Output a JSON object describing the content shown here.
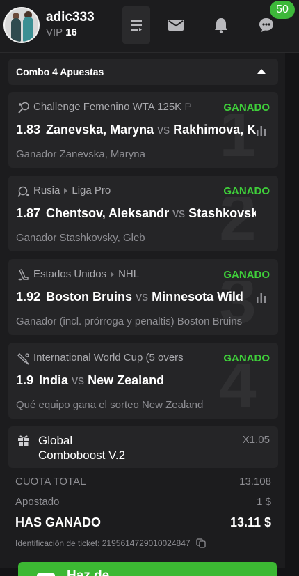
{
  "header": {
    "username": "adic333",
    "vip_label": "VIP",
    "vip_level": "16",
    "chat_badge_count": "50"
  },
  "combo": {
    "title": "Combo 4 Apuestas"
  },
  "legs": [
    {
      "number": "1",
      "sport_icon": "tennis-icon",
      "league_parts": [
        "Challenge Femenino WTA 125K "
      ],
      "league_fade": "P",
      "status": "GANADO",
      "odds": "1.83",
      "home": "Zanevska, Maryna",
      "vs": "vs",
      "away": "Rakhimova, K",
      "selection": "Ganador Zanevska, Maryna",
      "has_stats": true
    },
    {
      "number": "2",
      "sport_icon": "table-tennis-icon",
      "league_parts": [
        "Rusia",
        "Liga Pro"
      ],
      "league_fade": "",
      "status": "GANADO",
      "odds": "1.87",
      "home": "Chentsov, Aleksandr",
      "vs": "vs",
      "away": "Stashkovsk",
      "selection": "Ganador Stashkovsky, Gleb",
      "has_stats": false
    },
    {
      "number": "3",
      "sport_icon": "hockey-icon",
      "league_parts": [
        "Estados Unidos",
        "NHL"
      ],
      "league_fade": "",
      "status": "GANADO",
      "odds": "1.92",
      "home": "Boston Bruins",
      "vs": "vs",
      "away": "Minnesota Wild",
      "selection": "Ganador (incl. prórroga y penaltis) Boston Bruins",
      "has_stats": true
    },
    {
      "number": "4",
      "sport_icon": "cricket-icon",
      "league_parts": [
        "International World Cup (5 overs"
      ],
      "league_fade": "",
      "status": "GANADO",
      "odds": "1.9",
      "home": "India",
      "vs": "vs",
      "away": "New Zealand",
      "selection": "Qué equipo gana el sorteo New Zealand",
      "has_stats": false
    }
  ],
  "boost": {
    "line1": "Global",
    "line2": "Comboboost V.2",
    "multiplier": "X1.05"
  },
  "summary": {
    "total_odds_label": "CUOTA TOTAL",
    "total_odds_value": "13.108",
    "stake_label": "Apostado",
    "stake_value": "1 $",
    "won_label": "HAS GANADO",
    "won_value": "13.11 $",
    "ticket_label": "Identificación de ticket:",
    "ticket_id": "2195614729010024847"
  },
  "cta": {
    "label": "Haz de"
  },
  "colors": {
    "win_green": "#3fcf3a",
    "badge_green": "#3db83a",
    "panel": "#1c1c1e",
    "card": "#252527"
  }
}
